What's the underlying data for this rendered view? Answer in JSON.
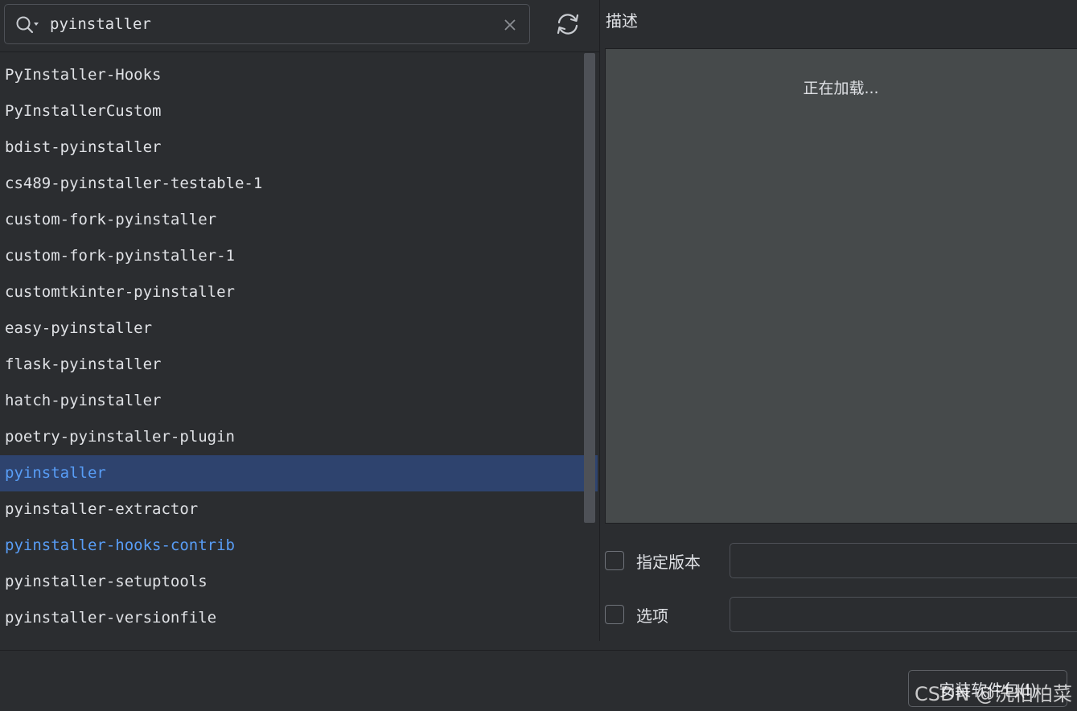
{
  "search": {
    "value": "pyinstaller",
    "icon": "search-icon",
    "clear_icon": "close-icon",
    "refresh_icon": "refresh-icon"
  },
  "packages": [
    {
      "name": "PyInstaller-Hooks",
      "installed": false,
      "selected": false
    },
    {
      "name": "PyInstallerCustom",
      "installed": false,
      "selected": false
    },
    {
      "name": "bdist-pyinstaller",
      "installed": false,
      "selected": false
    },
    {
      "name": "cs489-pyinstaller-testable-1",
      "installed": false,
      "selected": false
    },
    {
      "name": "custom-fork-pyinstaller",
      "installed": false,
      "selected": false
    },
    {
      "name": "custom-fork-pyinstaller-1",
      "installed": false,
      "selected": false
    },
    {
      "name": "customtkinter-pyinstaller",
      "installed": false,
      "selected": false
    },
    {
      "name": "easy-pyinstaller",
      "installed": false,
      "selected": false
    },
    {
      "name": "flask-pyinstaller",
      "installed": false,
      "selected": false
    },
    {
      "name": "hatch-pyinstaller",
      "installed": false,
      "selected": false
    },
    {
      "name": "poetry-pyinstaller-plugin",
      "installed": false,
      "selected": false
    },
    {
      "name": "pyinstaller",
      "installed": true,
      "selected": true
    },
    {
      "name": "pyinstaller-extractor",
      "installed": false,
      "selected": false
    },
    {
      "name": "pyinstaller-hooks-contrib",
      "installed": true,
      "selected": false
    },
    {
      "name": "pyinstaller-setuptools",
      "installed": false,
      "selected": false
    },
    {
      "name": "pyinstaller-versionfile",
      "installed": false,
      "selected": false
    }
  ],
  "description": {
    "label": "描述",
    "loading_text": "正在加载..."
  },
  "options": {
    "version_label": "指定版本",
    "version_value": "",
    "extra_label": "选项",
    "extra_value": ""
  },
  "install_button": {
    "label": "安装软件包(I)"
  },
  "watermark": "CSDN @洗柏柏菜",
  "colors": {
    "background": "#2b2d30",
    "selected_row": "#2e436e",
    "installed_text": "#589df6",
    "description_bg": "#464a4b"
  }
}
